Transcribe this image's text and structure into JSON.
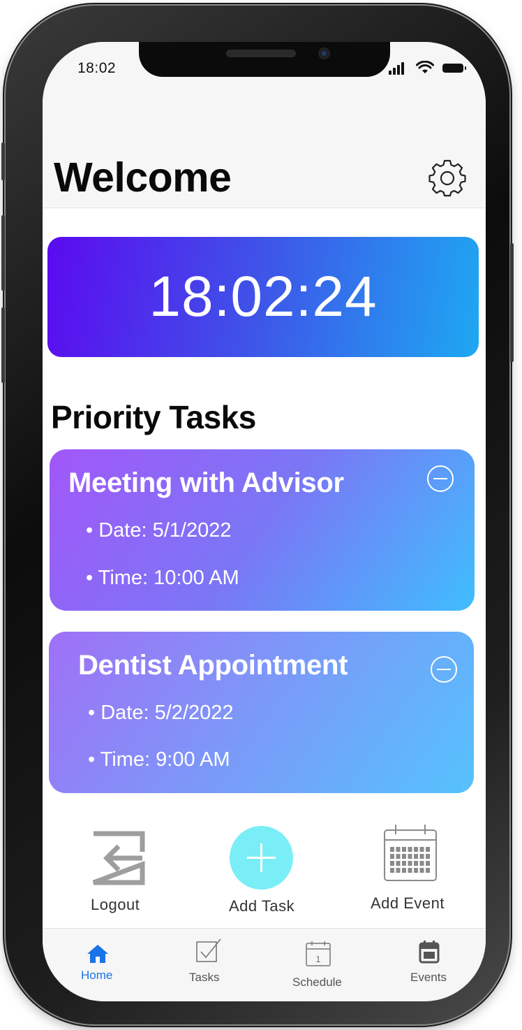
{
  "status_bar": {
    "time": "18:02"
  },
  "header": {
    "title": "Welcome"
  },
  "clock": {
    "time": "18:02:24"
  },
  "priority": {
    "title": "Priority Tasks",
    "tasks": [
      {
        "title": "Meeting with Advisor",
        "date": "• Date: 5/1/2022",
        "time": "• Time: 10:00 AM"
      },
      {
        "title": "Dentist Appointment",
        "date": "• Date: 5/2/2022",
        "time": "• Time: 9:00 AM"
      }
    ]
  },
  "actions": {
    "logout": "Logout",
    "add_task": "Add Task",
    "add_event": "Add Event"
  },
  "tabs": {
    "home": "Home",
    "tasks": "Tasks",
    "schedule": "Schedule",
    "schedule_icon_day": "1",
    "events": "Events",
    "active": "Home"
  },
  "colors": {
    "clock_gradient": [
      "#5b0af0",
      "#1ea8f2"
    ],
    "add_task_circle": "#79eef6",
    "active_tab": "#1a73e8"
  },
  "icons": {
    "settings": "gear-icon",
    "remove": "minus-circle-icon",
    "logout": "logout-icon",
    "add": "plus-icon",
    "calendar": "calendar-icon",
    "home": "home-icon",
    "tasks": "checkbox-icon",
    "schedule": "calendar-day-icon",
    "events": "calendar-icon"
  }
}
